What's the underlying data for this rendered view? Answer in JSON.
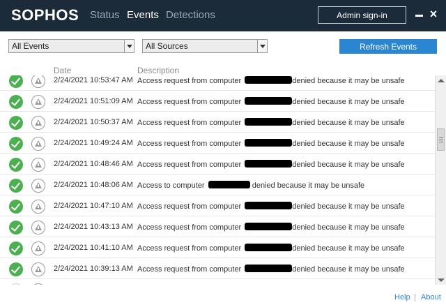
{
  "header": {
    "logo": "SOPHOS",
    "tabs": [
      {
        "label": "Status",
        "active": false
      },
      {
        "label": "Events",
        "active": true
      },
      {
        "label": "Detections",
        "active": false
      }
    ],
    "admin_signin": "Admin sign-in",
    "minimize": "–",
    "close": "×"
  },
  "toolbar": {
    "event_filter": "All Events",
    "source_filter": "All Sources",
    "refresh": "Refresh Events"
  },
  "table": {
    "columns": [
      "Date",
      "Description"
    ],
    "rows": [
      {
        "date": "2/24/2021 10:53:47 AM",
        "desc_pre": "Access request from computer",
        "desc_post": "denied because it may be unsafe"
      },
      {
        "date": "2/24/2021 10:51:09 AM",
        "desc_pre": "Access request from computer",
        "desc_post": "denied because it may be unsafe"
      },
      {
        "date": "2/24/2021 10:50:37 AM",
        "desc_pre": "Access request from computer",
        "desc_post": "denied because it may be unsafe"
      },
      {
        "date": "2/24/2021 10:49:24 AM",
        "desc_pre": "Access request from computer",
        "desc_post": "denied because it may be unsafe"
      },
      {
        "date": "2/24/2021 10:48:46 AM",
        "desc_pre": "Access request from computer",
        "desc_post": "denied because it may be unsafe"
      },
      {
        "date": "2/24/2021 10:48:06 AM",
        "desc_pre": "Access to computer",
        "desc_post": "denied because it may be unsafe"
      },
      {
        "date": "2/24/2021 10:47:10 AM",
        "desc_pre": "Access request from computer",
        "desc_post": "denied because it may be unsafe"
      },
      {
        "date": "2/24/2021 10:43:13 AM",
        "desc_pre": "Access request from computer",
        "desc_post": "denied because it may be unsafe"
      },
      {
        "date": "2/24/2021 10:41:10 AM",
        "desc_pre": "Access request from computer",
        "desc_post": "denied because it may be unsafe"
      },
      {
        "date": "2/24/2021 10:39:13 AM",
        "desc_pre": "Access request from computer",
        "desc_post": "denied because it may be unsafe"
      }
    ]
  },
  "footer": {
    "help": "Help",
    "separator": "|",
    "about": "About"
  },
  "colors": {
    "header_bg": "#1c2b39",
    "accent": "#2a86d1",
    "success": "#4caf50"
  }
}
